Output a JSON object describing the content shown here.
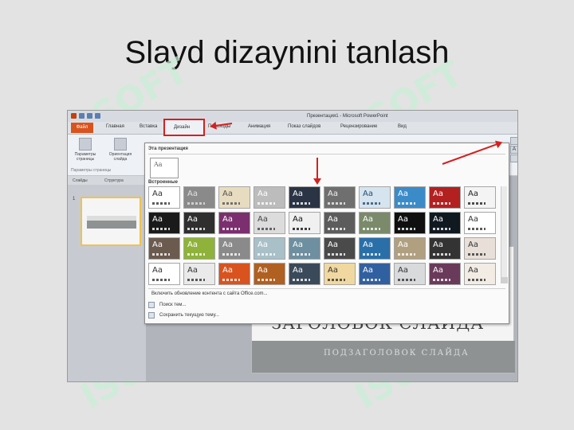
{
  "slide": {
    "title": "Slayd dizaynini tanlash"
  },
  "watermark": {
    "text": "ISOFT"
  },
  "window": {
    "title": "Презентация1 - Microsoft PowerPoint"
  },
  "ribbon": {
    "tabs": [
      {
        "label": "Файл"
      },
      {
        "label": "Главная"
      },
      {
        "label": "Вставка"
      },
      {
        "label": "Дизайн"
      },
      {
        "label": "Переходы"
      },
      {
        "label": "Анимация"
      },
      {
        "label": "Показ слайдов"
      },
      {
        "label": "Рецензирование"
      },
      {
        "label": "Вид"
      }
    ],
    "buttons": [
      {
        "label": "Параметры страницы"
      },
      {
        "label": "Ориентация слайда"
      }
    ],
    "group_label": "Параметры страницы"
  },
  "panel": {
    "tabs": [
      "Слайды",
      "Структура"
    ],
    "slide_number": "1"
  },
  "gallery": {
    "section_current": "Эта презентация",
    "section_builtin": "Встроенные",
    "current_label": "Aa",
    "thumb_label": "Aa",
    "menu": [
      {
        "label": "Включить обновление контента с сайта Office.com..."
      },
      {
        "label": "Поиск тем..."
      },
      {
        "label": "Сохранить текущую тему..."
      }
    ]
  },
  "preview": {
    "heading": "ЗАГОЛОВОК СЛАЙДА",
    "subheading": "ПОДЗАГОЛОВОК СЛАЙДА"
  },
  "themes": [
    {
      "bg": "#ffffff",
      "fg": "#333333"
    },
    {
      "bg": "#8a8a8a",
      "fg": "#e0e0e0"
    },
    {
      "bg": "#e8dcc0",
      "fg": "#555555"
    },
    {
      "bg": "#bcbcbc",
      "fg": "#ffffff"
    },
    {
      "bg": "#2a3444",
      "fg": "#ffffff"
    },
    {
      "bg": "#6f6f6f",
      "fg": "#f0f0f0"
    },
    {
      "bg": "#d6e4ef",
      "fg": "#2a4d6e"
    },
    {
      "bg": "#3b8bc9",
      "fg": "#ffffff"
    },
    {
      "bg": "#b32020",
      "fg": "#ffffff"
    },
    {
      "bg": "#f4f4f4",
      "fg": "#222222"
    },
    {
      "bg": "#1a1a1a",
      "fg": "#ffffff"
    },
    {
      "bg": "#2f2f2f",
      "fg": "#ffffff"
    },
    {
      "bg": "#7b2f6e",
      "fg": "#ffffff"
    },
    {
      "bg": "#dcdcdc",
      "fg": "#444444"
    },
    {
      "bg": "#f0f0f0",
      "fg": "#111111"
    },
    {
      "bg": "#5c5c5c",
      "fg": "#ffffff"
    },
    {
      "bg": "#7a8a6a",
      "fg": "#ffffff"
    },
    {
      "bg": "#0f0f0f",
      "fg": "#ffffff"
    },
    {
      "bg": "#101820",
      "fg": "#ffffff"
    },
    {
      "bg": "#ffffff",
      "fg": "#333333"
    },
    {
      "bg": "#6b5a4e",
      "fg": "#ffffff"
    },
    {
      "bg": "#8fb33a",
      "fg": "#ffffff"
    },
    {
      "bg": "#8a8a8a",
      "fg": "#ffffff"
    },
    {
      "bg": "#a9c0c8",
      "fg": "#ffffff"
    },
    {
      "bg": "#6e8fa0",
      "fg": "#ffffff"
    },
    {
      "bg": "#4a4a4a",
      "fg": "#ffffff"
    },
    {
      "bg": "#2a6fa8",
      "fg": "#ffffff"
    },
    {
      "bg": "#b0a080",
      "fg": "#ffffff"
    },
    {
      "bg": "#333333",
      "fg": "#ffffff"
    },
    {
      "bg": "#e8e0d8",
      "fg": "#333333"
    },
    {
      "bg": "#ffffff",
      "fg": "#333333"
    },
    {
      "bg": "#eaeaea",
      "fg": "#333333"
    },
    {
      "bg": "#d9531e",
      "fg": "#ffffff"
    },
    {
      "bg": "#b06020",
      "fg": "#ffffff"
    },
    {
      "bg": "#3a4a5a",
      "fg": "#ffffff"
    },
    {
      "bg": "#f0d8a0",
      "fg": "#333333"
    },
    {
      "bg": "#3060a0",
      "fg": "#ffffff"
    },
    {
      "bg": "#d8dadc",
      "fg": "#333333"
    },
    {
      "bg": "#6a3a5a",
      "fg": "#ffffff"
    },
    {
      "bg": "#f2ece4",
      "fg": "#333333"
    }
  ]
}
